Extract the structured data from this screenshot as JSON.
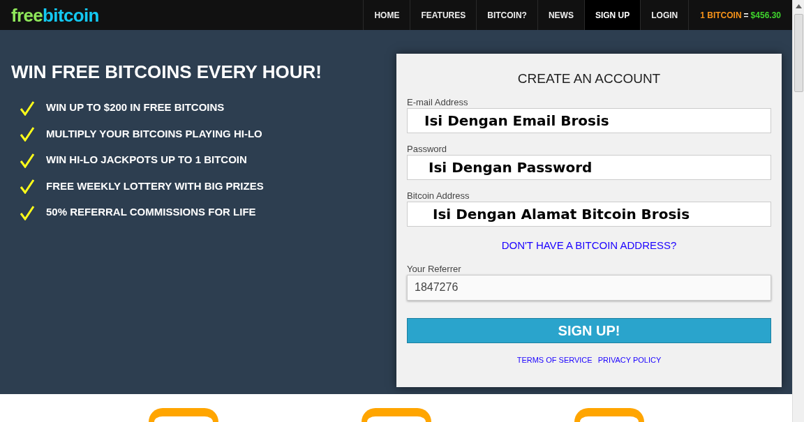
{
  "logo": {
    "part_1": "free",
    "part_2": "bitcoin"
  },
  "nav": [
    {
      "label": "HOME",
      "selected": false
    },
    {
      "label": "FEATURES",
      "selected": false
    },
    {
      "label": "BITCOIN?",
      "selected": false
    },
    {
      "label": "NEWS",
      "selected": false
    },
    {
      "label": "SIGN UP",
      "selected": true
    },
    {
      "label": "LOGIN",
      "selected": false
    }
  ],
  "price": {
    "unit": "1 BITCOIN",
    "equals": "=",
    "value": "$456.30"
  },
  "hero": {
    "title": "WIN FREE BITCOINS EVERY HOUR!",
    "features": [
      "WIN UP TO $200 IN FREE BITCOINS",
      "MULTIPLY YOUR BITCOINS PLAYING HI-LO",
      "WIN HI-LO JACKPOTS UP TO 1 BITCOIN",
      "FREE WEEKLY LOTTERY WITH BIG PRIZES",
      "50% REFERRAL COMMISSIONS FOR LIFE"
    ]
  },
  "form": {
    "title": "CREATE AN ACCOUNT",
    "fields": [
      {
        "label": "E-mail Address",
        "value": "Isi Dengan Email Brosis",
        "kind": "overlay"
      },
      {
        "label": "Password",
        "value": "Isi Dengan Password",
        "kind": "overlay"
      },
      {
        "label": "Bitcoin Address",
        "value": "Isi Dengan Alamat Bitcoin Brosis",
        "kind": "overlay"
      }
    ],
    "help_link": "DON'T HAVE A BITCOIN ADDRESS?",
    "referrer": {
      "label": "Your Referrer",
      "value": "1847276",
      "kind": "plain"
    },
    "submit": "SIGN UP!",
    "links": [
      "TERMS OF SERVICE",
      "PRIVACY POLICY"
    ]
  }
}
